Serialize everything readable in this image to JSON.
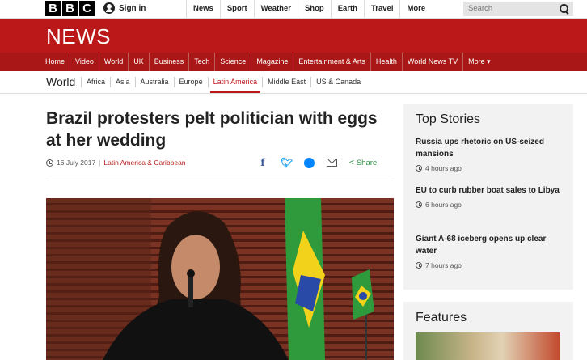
{
  "topbar": {
    "logo_letters": [
      "B",
      "B",
      "C"
    ],
    "signin": "Sign in",
    "nav": [
      "News",
      "Sport",
      "Weather",
      "Shop",
      "Earth",
      "Travel",
      "More"
    ],
    "search_placeholder": "Search"
  },
  "news": {
    "logo": "NEWS",
    "nav": [
      "Home",
      "Video",
      "World",
      "UK",
      "Business",
      "Tech",
      "Science",
      "Magazine",
      "Entertainment & Arts",
      "Health",
      "World News TV",
      "More ▾"
    ]
  },
  "world": {
    "title": "World",
    "nav": [
      "Africa",
      "Asia",
      "Australia",
      "Europe",
      "Latin America",
      "Middle East",
      "US & Canada"
    ],
    "active": "Latin America"
  },
  "article": {
    "headline": "Brazil protesters pelt politician with eggs at her wedding",
    "date": "16 July 2017",
    "category": "Latin America & Caribbean",
    "share_label": "Share"
  },
  "sidebar": {
    "top_stories_title": "Top Stories",
    "stories": [
      {
        "title": "Russia ups rhetoric on US-seized mansions",
        "time": "4 hours ago"
      },
      {
        "title": "EU to curb rubber boat sales to Libya",
        "time": "6 hours ago"
      },
      {
        "title": "Giant A-68 iceberg opens up clear water",
        "time": "7 hours ago"
      }
    ],
    "features_title": "Features"
  },
  "colors": {
    "brand_red": "#bb1919",
    "nav_red": "#a91717",
    "share_green": "#2a8a3e"
  }
}
